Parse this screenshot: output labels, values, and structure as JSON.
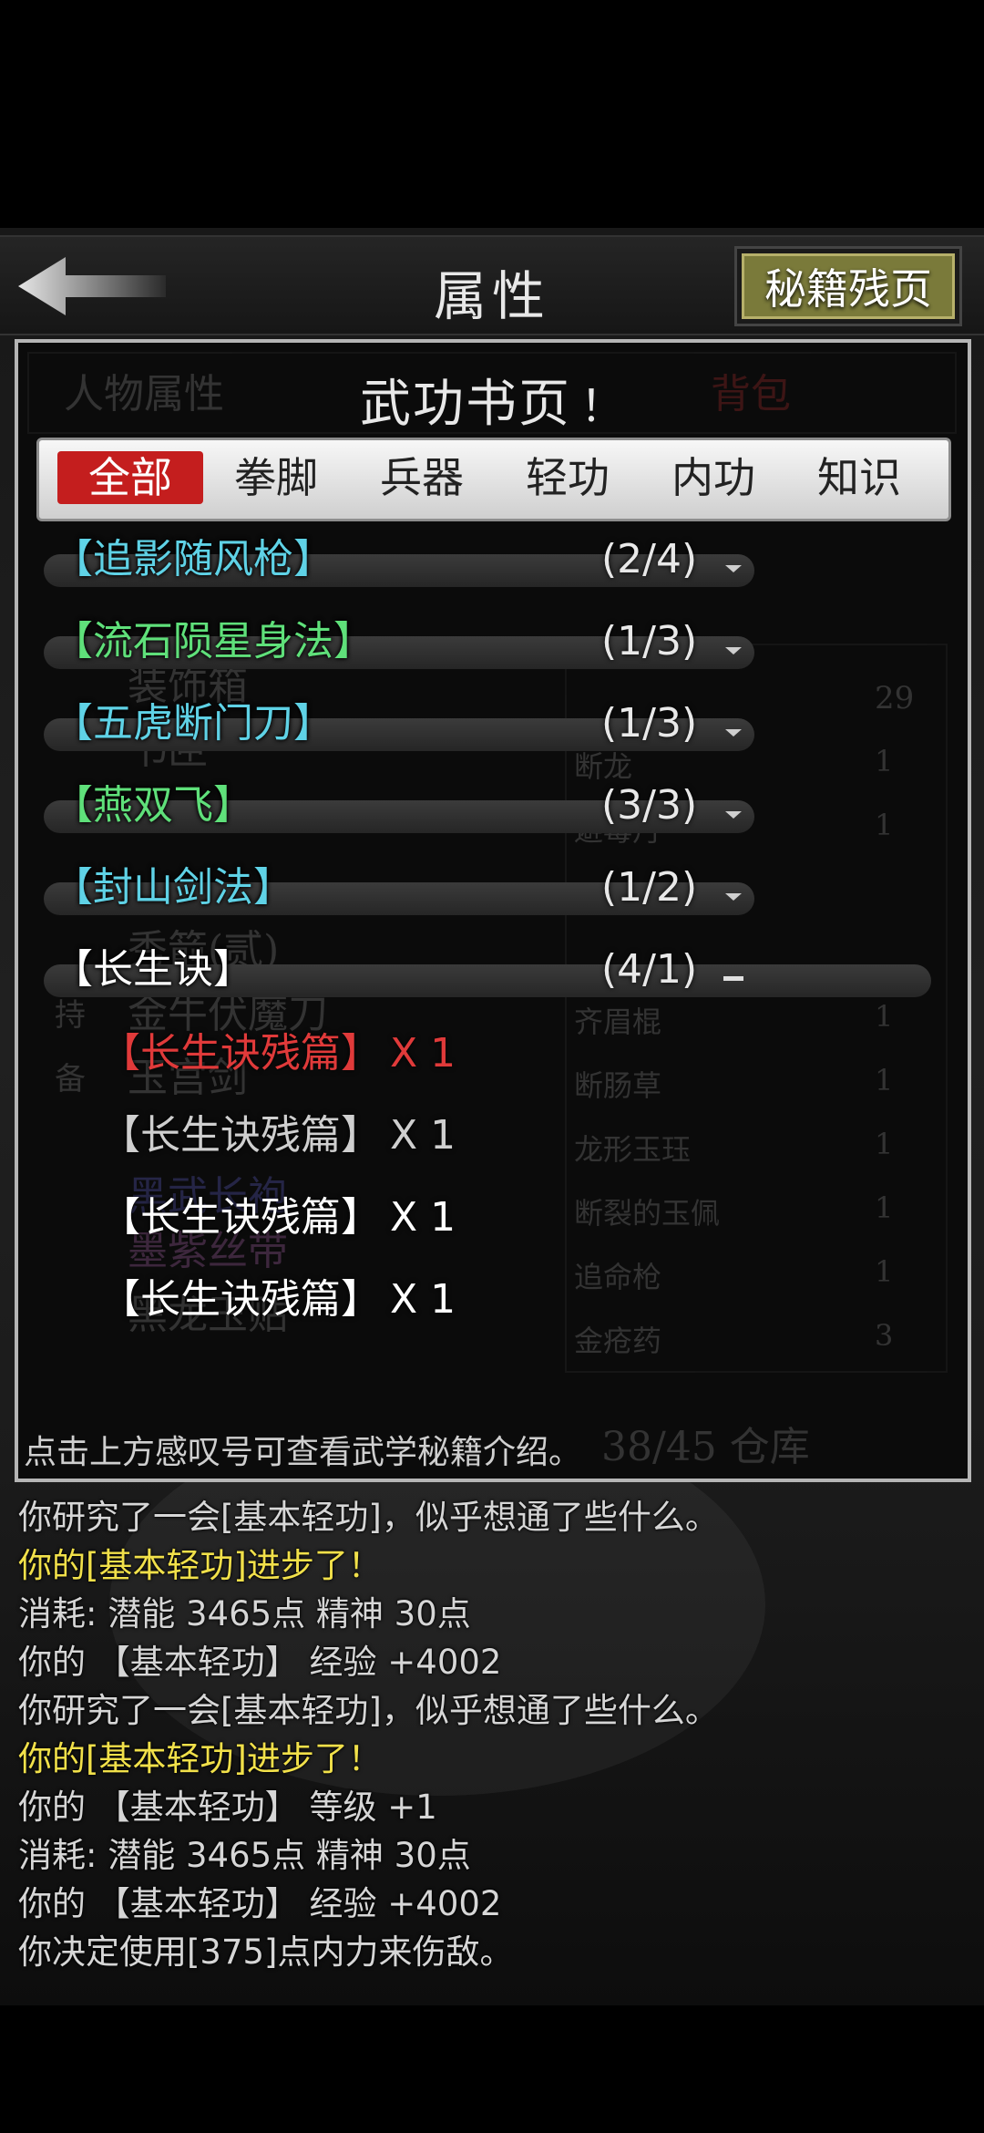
{
  "header": {
    "title": "属性",
    "right_button": "秘籍残页"
  },
  "popup": {
    "title": "武功书页",
    "info_mark": "！",
    "hint": "点击上方感叹号可查看武学秘籍介绍。",
    "background_text": {
      "tab_character": "人物属性",
      "tab_bag": "背包",
      "capacity": "38/45 仓库",
      "items": [
        "装饰箱",
        "书匣",
        "秀箭(贰)",
        "金牛伏魔刀",
        "玉宫剑",
        "黑武长袍",
        "墨紫丝带",
        "黑龙玉贴"
      ],
      "side_labels": [
        "持",
        "备"
      ],
      "inventory": [
        {
          "name": "断龙",
          "count": "1"
        },
        {
          "name": "避毒丹",
          "count": "1"
        },
        {
          "name": "齐眉棍",
          "count": "1"
        },
        {
          "name": "断肠草",
          "count": "1"
        },
        {
          "name": "龙形玉珏",
          "count": "1"
        },
        {
          "name": "断裂的玉佩",
          "count": "1"
        },
        {
          "name": "追命枪",
          "count": "1"
        },
        {
          "name": "金疮药",
          "count": "3"
        }
      ],
      "top_count": "29"
    }
  },
  "tabs": [
    {
      "label": "全部",
      "active": true
    },
    {
      "label": "拳脚",
      "active": false
    },
    {
      "label": "兵器",
      "active": false
    },
    {
      "label": "轻功",
      "active": false
    },
    {
      "label": "内功",
      "active": false
    },
    {
      "label": "知识",
      "active": false
    }
  ],
  "books": [
    {
      "name": "【追影随风枪】",
      "count": "(2/4)",
      "color": "#5fd2e6",
      "expanded": false
    },
    {
      "name": "【流石陨星身法】",
      "count": "(1/3)",
      "color": "#5fe07a",
      "expanded": false
    },
    {
      "name": "【五虎断门刀】",
      "count": "(1/3)",
      "color": "#5fd2e6",
      "expanded": false
    },
    {
      "name": "【燕双飞】",
      "count": "(3/3)",
      "color": "#5fe07a",
      "expanded": false
    },
    {
      "name": "【封山剑法】",
      "count": "(1/2)",
      "color": "#5fd2e6",
      "expanded": false
    },
    {
      "name": "【长生诀】",
      "count": "(4/1)",
      "color": "#ffffff",
      "expanded": true
    }
  ],
  "fragments": [
    {
      "name": "【长生诀残篇】",
      "qty": "X 1",
      "color": "#e03a3a"
    },
    {
      "name": "【长生诀残篇】",
      "qty": "X 1",
      "color": "#cfcfcf"
    },
    {
      "name": "【长生诀残篇】",
      "qty": "X 1",
      "color": "#ffffff"
    },
    {
      "name": "【长生诀残篇】",
      "qty": "X 1",
      "color": "#ffffff"
    }
  ],
  "log": [
    {
      "text": "你研究了一会[基本轻功]，似乎想通了些什么。",
      "color": "#d6d6d6"
    },
    {
      "text": "你的[基本轻功]进步了！",
      "color": "#f1e04a"
    },
    {
      "text": "消耗: 潜能 3465点  精神 30点",
      "color": "#d6d6d6"
    },
    {
      "text": "你的 【基本轻功】 经验 +4002",
      "color": "#d6d6d6"
    },
    {
      "text": "你研究了一会[基本轻功]，似乎想通了些什么。",
      "color": "#d6d6d6"
    },
    {
      "text": "你的[基本轻功]进步了！",
      "color": "#f1e04a"
    },
    {
      "text": "你的 【基本轻功】 等级 +1",
      "color": "#d6d6d6"
    },
    {
      "text": "消耗: 潜能 3465点  精神 30点",
      "color": "#d6d6d6"
    },
    {
      "text": "你的 【基本轻功】 经验 +4002",
      "color": "#d6d6d6"
    },
    {
      "text": "你决定使用[375]点内力来伤敌。",
      "color": "#d6d6d6"
    }
  ],
  "icons": {
    "back": "arrow-left-icon",
    "collapsed": "chevron-down-icon",
    "expanded": "minus-icon"
  }
}
